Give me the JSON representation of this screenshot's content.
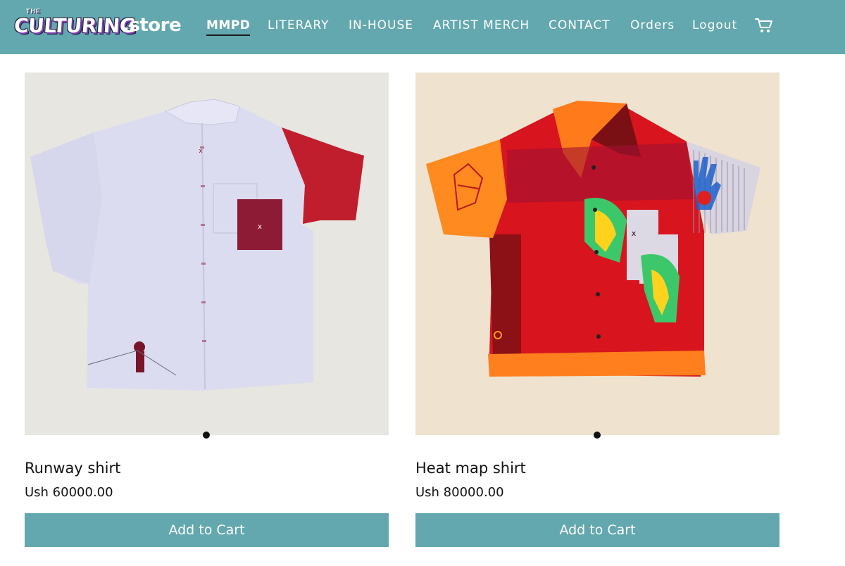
{
  "brand": {
    "small": "THE",
    "main": "CULTURING",
    "suffix": ".store"
  },
  "nav": {
    "items": [
      {
        "label": "MMPD",
        "active": true
      },
      {
        "label": "LITERARY"
      },
      {
        "label": "IN-HOUSE"
      },
      {
        "label": "ARTIST MERCH"
      },
      {
        "label": "CONTACT"
      },
      {
        "label": "Orders"
      },
      {
        "label": "Logout"
      }
    ],
    "cart_icon": "shopping-cart-icon"
  },
  "products": [
    {
      "name": "Runway shirt",
      "price": "Ush 60000.00",
      "button": "Add to Cart",
      "image_bg": "#e7e6e0"
    },
    {
      "name": "Heat map shirt",
      "price": "Ush 80000.00",
      "button": "Add to Cart",
      "image_bg": "#efe3cf"
    }
  ],
  "colors": {
    "accent": "#63a8ae",
    "text": "#111111"
  }
}
